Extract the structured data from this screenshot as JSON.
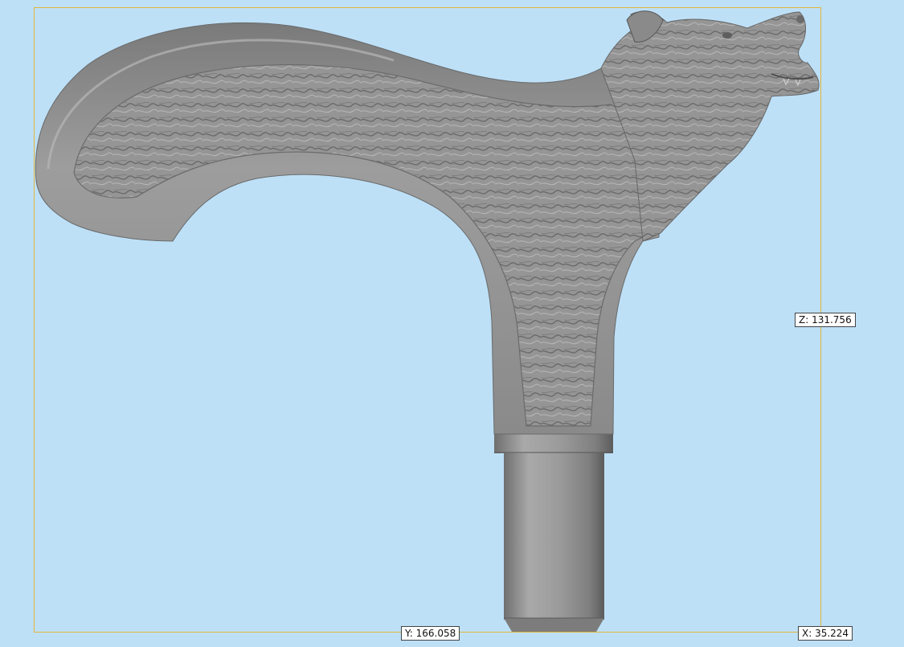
{
  "viewport": {
    "background_color": "#bde0f7",
    "bounding_box_color": "#e3b53a",
    "model_color": "#9a9a9a"
  },
  "dimensions": {
    "z_label": "Z: 131.756",
    "y_label": "Y: 166.058",
    "x_label": "X: 35.224"
  },
  "model": {
    "name_icon": "cane-handle-wolf-head-model"
  }
}
